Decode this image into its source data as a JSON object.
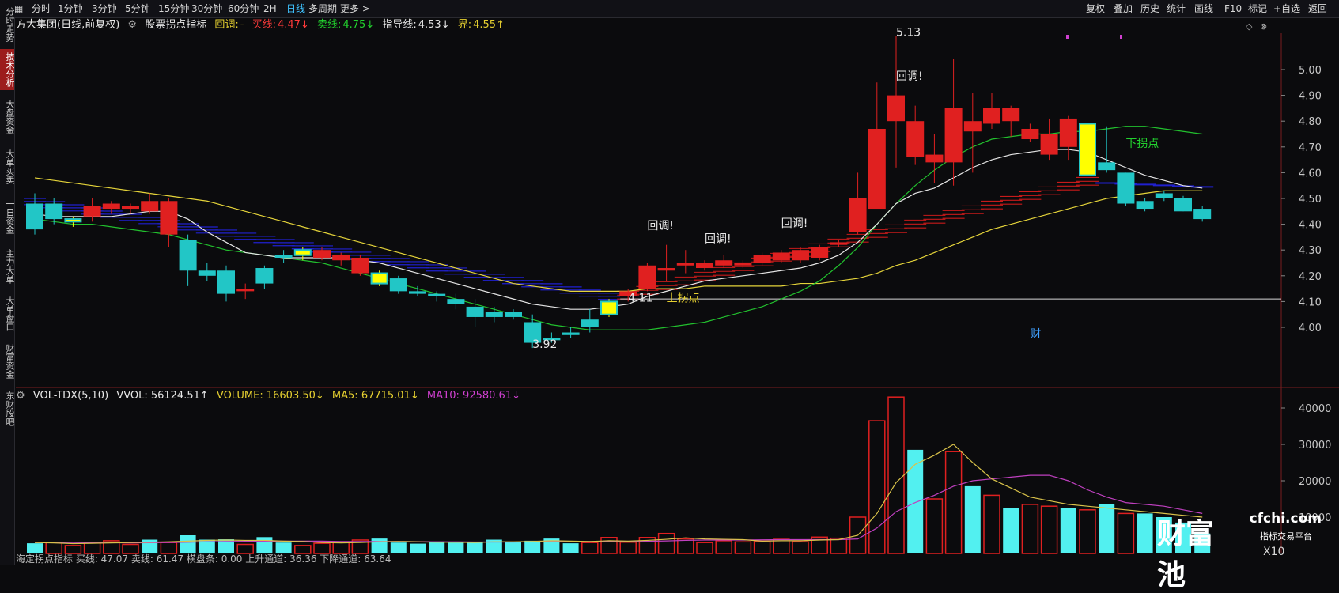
{
  "sidebar": {
    "tabs": [
      {
        "label": "分时走势",
        "active": false
      },
      {
        "label": "技术分析",
        "active": true
      },
      {
        "label": "大盘资金",
        "active": false
      },
      {
        "label": "大单买卖",
        "active": false
      },
      {
        "label": "一日资金",
        "active": false
      },
      {
        "label": "主力大单",
        "active": false
      },
      {
        "label": "大单盘口",
        "active": false
      },
      {
        "label": "财富资金",
        "active": false
      },
      {
        "label": "东财股吧",
        "active": false
      }
    ]
  },
  "topbar": {
    "left": [
      "分时",
      "1分钟",
      "3分钟",
      "5分钟",
      "15分钟",
      "30分钟",
      "60分钟",
      "2H",
      "日线",
      "多周期",
      "更多 >"
    ],
    "active": "日线",
    "right": [
      "复权",
      "叠加",
      "历史",
      "统计",
      "画线",
      "F10",
      "标记",
      "+自选",
      "返回"
    ]
  },
  "info": {
    "title": "方大集团(日线,前复权)",
    "indicator": "股票拐点指标",
    "huitiao_label": "回调:",
    "huitiao_value": "-",
    "maixian_label": "买线:",
    "maixian_value": "4.47↓",
    "maichu_label": "卖线:",
    "maichu_value": "4.75↓",
    "zhidao_label": "指导线:",
    "zhidao_value": "4.53↓",
    "jie_label": "界:",
    "jie_value": "4.55↑"
  },
  "vol_info": {
    "name": "VOL-TDX(5,10)",
    "vvol": "VVOL: 56124.51↑",
    "volume": "VOLUME: 16603.50↓",
    "ma5": "MA5: 67715.01↓",
    "ma10": "MA10: 92580.61↓"
  },
  "bottom_text": "海定拐点指标  买线: 47.07  卖线: 61.47  横盘条: 0.00  上升通道: 36.36  下降通道: 63.64",
  "watermark": {
    "logo": "财富池",
    "url": "cfchi.com",
    "sub": "指标交易平台"
  },
  "x10_label": "X10",
  "colors": {
    "up": "#e02020",
    "down": "#22c6c6",
    "yellow": "#ffff00",
    "ma_white": "#e6e6e6",
    "ma_yellow": "#e5d43a",
    "ma_green": "#22c02e",
    "vol_ma5": "#d9c24a",
    "vol_ma10": "#c040c0",
    "blue_band": "#2020d0",
    "red_band": "#c81a1a"
  },
  "chart_data": [
    {
      "type": "candlestick",
      "title": "方大集团(日线,前复权)",
      "ylim": [
        3.92,
        5.13
      ],
      "y_ticks": [
        4.0,
        4.1,
        4.2,
        4.3,
        4.4,
        4.5,
        4.6,
        4.7,
        4.8,
        4.9,
        5.0
      ],
      "candles": [
        {
          "o": 4.38,
          "h": 4.52,
          "l": 4.36,
          "c": 4.48,
          "k": "down"
        },
        {
          "o": 4.48,
          "h": 4.5,
          "l": 4.4,
          "c": 4.42,
          "k": "down"
        },
        {
          "o": 4.41,
          "h": 4.43,
          "l": 4.39,
          "c": 4.42,
          "k": "yellow"
        },
        {
          "o": 4.43,
          "h": 4.5,
          "l": 4.41,
          "c": 4.47,
          "k": "up"
        },
        {
          "o": 4.46,
          "h": 4.49,
          "l": 4.44,
          "c": 4.48,
          "k": "up"
        },
        {
          "o": 4.46,
          "h": 4.48,
          "l": 4.44,
          "c": 4.47,
          "k": "up"
        },
        {
          "o": 4.45,
          "h": 4.52,
          "l": 4.44,
          "c": 4.49,
          "k": "up"
        },
        {
          "o": 4.36,
          "h": 4.5,
          "l": 4.31,
          "c": 4.49,
          "k": "up"
        },
        {
          "o": 4.34,
          "h": 4.36,
          "l": 4.16,
          "c": 4.22,
          "k": "down"
        },
        {
          "o": 4.22,
          "h": 4.25,
          "l": 4.18,
          "c": 4.2,
          "k": "down"
        },
        {
          "o": 4.22,
          "h": 4.24,
          "l": 4.1,
          "c": 4.13,
          "k": "down"
        },
        {
          "o": 4.14,
          "h": 4.17,
          "l": 4.11,
          "c": 4.15,
          "k": "up"
        },
        {
          "o": 4.17,
          "h": 4.24,
          "l": 4.15,
          "c": 4.23,
          "k": "down"
        },
        {
          "o": 4.27,
          "h": 4.3,
          "l": 4.25,
          "c": 4.28,
          "k": "down"
        },
        {
          "o": 4.28,
          "h": 4.31,
          "l": 4.26,
          "c": 4.3,
          "k": "yellow"
        },
        {
          "o": 4.27,
          "h": 4.31,
          "l": 4.26,
          "c": 4.3,
          "k": "up"
        },
        {
          "o": 4.26,
          "h": 4.29,
          "l": 4.24,
          "c": 4.28,
          "k": "up"
        },
        {
          "o": 4.21,
          "h": 4.28,
          "l": 4.2,
          "c": 4.27,
          "k": "up"
        },
        {
          "o": 4.21,
          "h": 4.22,
          "l": 4.16,
          "c": 4.17,
          "k": "yellow"
        },
        {
          "o": 4.19,
          "h": 4.2,
          "l": 4.13,
          "c": 4.14,
          "k": "down"
        },
        {
          "o": 4.14,
          "h": 4.16,
          "l": 4.12,
          "c": 4.13,
          "k": "down"
        },
        {
          "o": 4.13,
          "h": 4.14,
          "l": 4.1,
          "c": 4.12,
          "k": "down"
        },
        {
          "o": 4.11,
          "h": 4.13,
          "l": 4.07,
          "c": 4.09,
          "k": "down"
        },
        {
          "o": 4.08,
          "h": 4.11,
          "l": 4.0,
          "c": 4.04,
          "k": "down"
        },
        {
          "o": 4.06,
          "h": 4.08,
          "l": 4.02,
          "c": 4.04,
          "k": "down"
        },
        {
          "o": 4.06,
          "h": 4.07,
          "l": 4.03,
          "c": 4.04,
          "k": "down"
        },
        {
          "o": 4.02,
          "h": 4.05,
          "l": 3.92,
          "c": 3.94,
          "k": "down"
        },
        {
          "o": 3.96,
          "h": 3.98,
          "l": 3.94,
          "c": 3.95,
          "k": "down"
        },
        {
          "o": 3.98,
          "h": 4.0,
          "l": 3.96,
          "c": 3.97,
          "k": "down"
        },
        {
          "o": 4.0,
          "h": 4.07,
          "l": 3.98,
          "c": 4.03,
          "k": "down"
        },
        {
          "o": 4.05,
          "h": 4.11,
          "l": 4.04,
          "c": 4.1,
          "k": "yellow"
        },
        {
          "o": 4.12,
          "h": 4.15,
          "l": 4.1,
          "c": 4.14,
          "k": "up"
        },
        {
          "o": 4.15,
          "h": 4.25,
          "l": 4.14,
          "c": 4.24,
          "k": "up"
        },
        {
          "o": 4.22,
          "h": 4.32,
          "l": 4.18,
          "c": 4.23,
          "k": "up"
        },
        {
          "o": 4.24,
          "h": 4.3,
          "l": 4.21,
          "c": 4.25,
          "k": "up"
        },
        {
          "o": 4.23,
          "h": 4.26,
          "l": 4.22,
          "c": 4.25,
          "k": "up"
        },
        {
          "o": 4.24,
          "h": 4.28,
          "l": 4.23,
          "c": 4.26,
          "k": "up"
        },
        {
          "o": 4.24,
          "h": 4.26,
          "l": 4.23,
          "c": 4.25,
          "k": "up"
        },
        {
          "o": 4.25,
          "h": 4.29,
          "l": 4.24,
          "c": 4.28,
          "k": "up"
        },
        {
          "o": 4.26,
          "h": 4.3,
          "l": 4.25,
          "c": 4.29,
          "k": "up"
        },
        {
          "o": 4.26,
          "h": 4.31,
          "l": 4.25,
          "c": 4.3,
          "k": "up"
        },
        {
          "o": 4.27,
          "h": 4.32,
          "l": 4.26,
          "c": 4.31,
          "k": "up"
        },
        {
          "o": 4.32,
          "h": 4.34,
          "l": 4.31,
          "c": 4.33,
          "k": "up"
        },
        {
          "o": 4.37,
          "h": 4.6,
          "l": 4.36,
          "c": 4.5,
          "k": "up"
        },
        {
          "o": 4.46,
          "h": 4.95,
          "l": 4.46,
          "c": 4.77,
          "k": "up"
        },
        {
          "o": 4.8,
          "h": 5.13,
          "l": 4.62,
          "c": 4.9,
          "k": "up"
        },
        {
          "o": 4.66,
          "h": 4.86,
          "l": 4.63,
          "c": 4.8,
          "k": "up"
        },
        {
          "o": 4.64,
          "h": 4.75,
          "l": 4.56,
          "c": 4.67,
          "k": "up"
        },
        {
          "o": 4.64,
          "h": 5.04,
          "l": 4.55,
          "c": 4.85,
          "k": "up"
        },
        {
          "o": 4.76,
          "h": 4.91,
          "l": 4.6,
          "c": 4.8,
          "k": "up"
        },
        {
          "o": 4.79,
          "h": 4.91,
          "l": 4.77,
          "c": 4.85,
          "k": "up"
        },
        {
          "o": 4.8,
          "h": 4.86,
          "l": 4.74,
          "c": 4.85,
          "k": "up"
        },
        {
          "o": 4.73,
          "h": 4.79,
          "l": 4.72,
          "c": 4.77,
          "k": "up"
        },
        {
          "o": 4.67,
          "h": 4.81,
          "l": 4.65,
          "c": 4.75,
          "k": "up"
        },
        {
          "o": 4.7,
          "h": 4.82,
          "l": 4.65,
          "c": 4.81,
          "k": "up"
        },
        {
          "o": 4.79,
          "h": 4.79,
          "l": 4.59,
          "c": 4.59,
          "k": "yellow"
        },
        {
          "o": 4.64,
          "h": 4.78,
          "l": 4.6,
          "c": 4.61,
          "k": "down"
        },
        {
          "o": 4.6,
          "h": 4.6,
          "l": 4.47,
          "c": 4.48,
          "k": "down"
        },
        {
          "o": 4.49,
          "h": 4.5,
          "l": 4.45,
          "c": 4.46,
          "k": "down"
        },
        {
          "o": 4.52,
          "h": 4.53,
          "l": 4.49,
          "c": 4.5,
          "k": "down"
        },
        {
          "o": 4.5,
          "h": 4.51,
          "l": 4.45,
          "c": 4.45,
          "k": "down"
        },
        {
          "o": 4.46,
          "h": 4.47,
          "l": 4.41,
          "c": 4.42,
          "k": "down"
        }
      ],
      "ma_white": [
        4.44,
        4.43,
        4.43,
        4.43,
        4.43,
        4.44,
        4.45,
        4.45,
        4.42,
        4.37,
        4.33,
        4.29,
        4.28,
        4.27,
        4.27,
        4.27,
        4.27,
        4.26,
        4.25,
        4.23,
        4.21,
        4.19,
        4.17,
        4.15,
        4.13,
        4.11,
        4.09,
        4.08,
        4.07,
        4.07,
        4.08,
        4.09,
        4.12,
        4.14,
        4.16,
        4.18,
        4.19,
        4.2,
        4.21,
        4.22,
        4.23,
        4.25,
        4.28,
        4.33,
        4.4,
        4.48,
        4.52,
        4.54,
        4.58,
        4.62,
        4.65,
        4.67,
        4.68,
        4.69,
        4.69,
        4.68,
        4.65,
        4.62,
        4.59,
        4.57,
        4.55,
        4.54
      ],
      "ma_yellow": [
        4.58,
        4.57,
        4.56,
        4.55,
        4.54,
        4.53,
        4.52,
        4.51,
        4.5,
        4.49,
        4.47,
        4.45,
        4.43,
        4.41,
        4.39,
        4.37,
        4.35,
        4.33,
        4.31,
        4.29,
        4.27,
        4.25,
        4.23,
        4.21,
        4.19,
        4.17,
        4.16,
        4.15,
        4.14,
        4.14,
        4.14,
        4.14,
        4.15,
        4.15,
        4.15,
        4.16,
        4.16,
        4.16,
        4.16,
        4.16,
        4.17,
        4.17,
        4.18,
        4.19,
        4.21,
        4.24,
        4.26,
        4.29,
        4.32,
        4.35,
        4.38,
        4.4,
        4.42,
        4.44,
        4.46,
        4.48,
        4.5,
        4.51,
        4.52,
        4.53,
        4.53,
        4.53
      ],
      "ma_green": [
        4.42,
        4.41,
        4.4,
        4.4,
        4.39,
        4.38,
        4.37,
        4.36,
        4.34,
        4.32,
        4.3,
        4.29,
        4.28,
        4.27,
        4.26,
        4.25,
        4.23,
        4.21,
        4.19,
        4.17,
        4.15,
        4.13,
        4.11,
        4.09,
        4.07,
        4.05,
        4.03,
        4.01,
        4.0,
        3.99,
        3.99,
        3.99,
        3.99,
        4.0,
        4.01,
        4.02,
        4.04,
        4.06,
        4.08,
        4.11,
        4.14,
        4.18,
        4.24,
        4.31,
        4.4,
        4.48,
        4.55,
        4.61,
        4.66,
        4.7,
        4.73,
        4.74,
        4.75,
        4.75,
        4.76,
        4.76,
        4.77,
        4.78,
        4.78,
        4.77,
        4.76,
        4.75
      ],
      "horizontal_line": 4.11,
      "annotations": [
        {
          "text": "5.13",
          "i": 45,
          "v": 5.13
        },
        {
          "text": "3.92",
          "i": 26,
          "v": 3.92
        },
        {
          "text": "4.11",
          "i": 31,
          "v": 4.1
        },
        {
          "text": "上拐点",
          "i": 33,
          "v": 4.1,
          "color": "yellow"
        },
        {
          "text": "下拐点",
          "i": 57,
          "v": 4.7,
          "color": "green"
        },
        {
          "text": "回调!",
          "i": 32,
          "v": 4.38
        },
        {
          "text": "回调!",
          "i": 35,
          "v": 4.33
        },
        {
          "text": "回调!",
          "i": 39,
          "v": 4.39
        },
        {
          "text": "回调!",
          "i": 45,
          "v": 4.96
        },
        {
          "text": "财",
          "i": 52,
          "v": 3.96
        }
      ]
    },
    {
      "type": "bar",
      "title": "VOL-TDX(5,10)",
      "ylim": [
        0,
        42000
      ],
      "y_ticks": [
        10000,
        20000,
        30000,
        40000
      ],
      "values": [
        2800,
        3000,
        2200,
        2900,
        3500,
        2500,
        3800,
        3000,
        5000,
        3800,
        3900,
        2500,
        4500,
        3000,
        2200,
        2800,
        3200,
        3700,
        4100,
        3000,
        2700,
        3300,
        3000,
        3100,
        3800,
        3200,
        3500,
        4100,
        2800,
        3000,
        4400,
        3100,
        4400,
        5500,
        4000,
        3000,
        3500,
        3200,
        3400,
        3900,
        3200,
        4500,
        4200,
        10000,
        36500,
        43000,
        28500,
        15000,
        28000,
        18500,
        16000,
        12500,
        13500,
        13000,
        12500,
        12000,
        13500,
        11000,
        11000,
        10000,
        8500,
        5500
      ],
      "kinds": [
        "down",
        "up",
        "up",
        "up",
        "up",
        "up",
        "down",
        "up",
        "down",
        "down",
        "down",
        "up",
        "down",
        "down",
        "up",
        "up",
        "up",
        "up",
        "down",
        "down",
        "down",
        "down",
        "down",
        "down",
        "down",
        "down",
        "down",
        "down",
        "down",
        "up",
        "up",
        "up",
        "up",
        "up",
        "up",
        "up",
        "up",
        "up",
        "up",
        "up",
        "up",
        "up",
        "up",
        "up",
        "up",
        "up",
        "down",
        "up",
        "up",
        "down",
        "up",
        "down",
        "up",
        "up",
        "down",
        "up",
        "down",
        "up",
        "down",
        "down",
        "down",
        "down"
      ],
      "ma5": [
        3000,
        2900,
        2700,
        2800,
        2900,
        3000,
        3100,
        3200,
        3400,
        3600,
        3700,
        3600,
        3600,
        3400,
        3300,
        3000,
        2900,
        3000,
        3200,
        3300,
        3200,
        3100,
        3100,
        3000,
        3200,
        3200,
        3300,
        3500,
        3400,
        3300,
        3500,
        3400,
        3600,
        3900,
        4300,
        4000,
        3900,
        3800,
        3400,
        3500,
        3500,
        3700,
        3800,
        5000,
        11000,
        19500,
        24500,
        27000,
        30000,
        25000,
        20500,
        18000,
        15500,
        14500,
        13500,
        13000,
        12500,
        12000,
        11500,
        11000,
        10500,
        10000
      ],
      "ma10": [
        3000,
        3000,
        3000,
        2950,
        2950,
        2900,
        2950,
        3000,
        3100,
        3200,
        3300,
        3350,
        3400,
        3400,
        3400,
        3400,
        3300,
        3300,
        3300,
        3300,
        3250,
        3200,
        3200,
        3150,
        3150,
        3150,
        3200,
        3200,
        3250,
        3300,
        3300,
        3300,
        3350,
        3450,
        3600,
        3700,
        3700,
        3700,
        3750,
        3800,
        3800,
        3800,
        3800,
        4000,
        7000,
        11500,
        14000,
        16000,
        18500,
        20000,
        20500,
        21000,
        21500,
        21500,
        20000,
        17500,
        15500,
        14000,
        13500,
        13000,
        12000,
        11000
      ]
    }
  ]
}
